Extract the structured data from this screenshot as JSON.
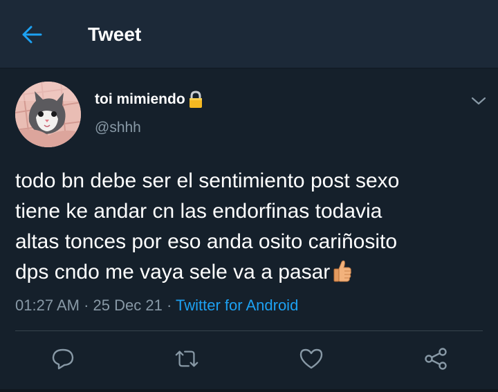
{
  "header": {
    "title": "Tweet",
    "back_icon": "arrow-left-icon",
    "accent_color": "#1da1f2"
  },
  "tweet": {
    "display_name": "toi mimiendo",
    "handle": "@shhh",
    "protected_icon": "lock-icon",
    "lines": [
      "todo bn debe ser el sentimiento post sexo",
      "tiene ke andar cn las endorfinas todavia",
      "altas tonces por eso anda osito cariñosito",
      "dps cndo me vaya sele va a pasar"
    ],
    "trailing_emoji": "thumbs-up-icon",
    "time": "01:27 AM",
    "date": "25 Dec 21",
    "separator": "·",
    "source": "Twitter for Android"
  },
  "actions": [
    {
      "name": "reply",
      "icon": "reply-icon"
    },
    {
      "name": "retweet",
      "icon": "retweet-icon"
    },
    {
      "name": "like",
      "icon": "heart-icon"
    },
    {
      "name": "share",
      "icon": "share-icon"
    }
  ],
  "colors": {
    "background": "#15202b",
    "header": "#1c2938",
    "secondary_text": "#8899a6",
    "divider": "#38444d"
  }
}
